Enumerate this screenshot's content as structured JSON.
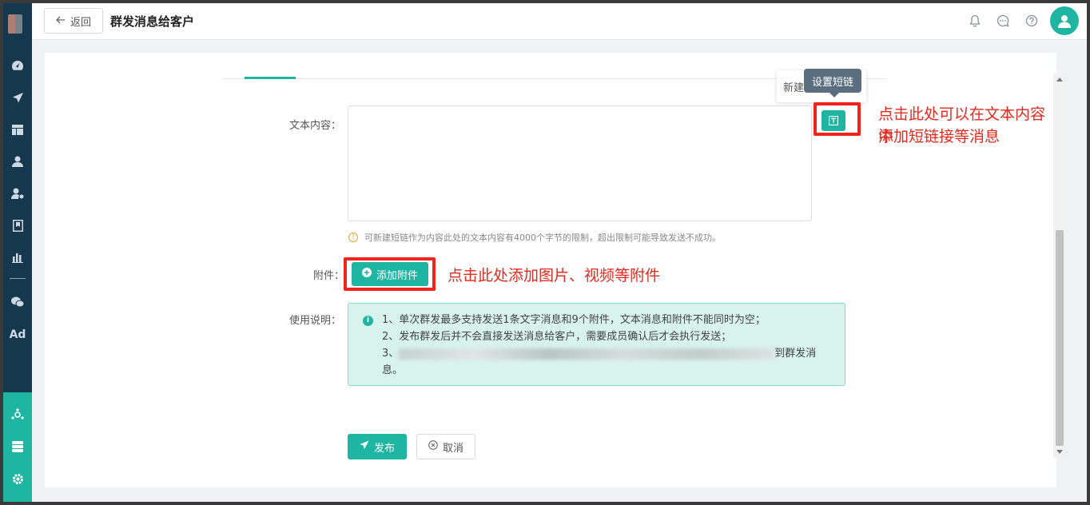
{
  "header": {
    "back_label": "返回",
    "title": "群发消息给客户"
  },
  "sidebar": {
    "ad_label": "Ad"
  },
  "form": {
    "text_label": "文本内容：",
    "popup_new": "新建",
    "tooltip": "设置短链",
    "hint": "可新建短链作为内容此处的文本内容有4000个字节的限制，超出限制可能导致发送不成功。",
    "attachment_label": "附件：",
    "add_attachment": "添加附件",
    "usage_label": "使用说明：",
    "usage_lines": [
      "1、单次群发最多支持发送1条文字消息和9个附件，文本消息和附件不能同时为空；",
      "2、发布群发后并不会直接发送消息给客户，需要成员确认后才会执行发送；",
      "3、",
      "到群发消",
      "息。"
    ],
    "publish": "发布",
    "cancel": "取消"
  },
  "annotations": {
    "shortlink_1": "点击此处可以在文本内容中",
    "shortlink_2": "添加短链接等消息",
    "attachment": "点击此处添加图片、视频等附件"
  },
  "colors": {
    "accent": "#1fb5a3",
    "sidebar": "#16384f",
    "annotation": "#e42a1e"
  }
}
